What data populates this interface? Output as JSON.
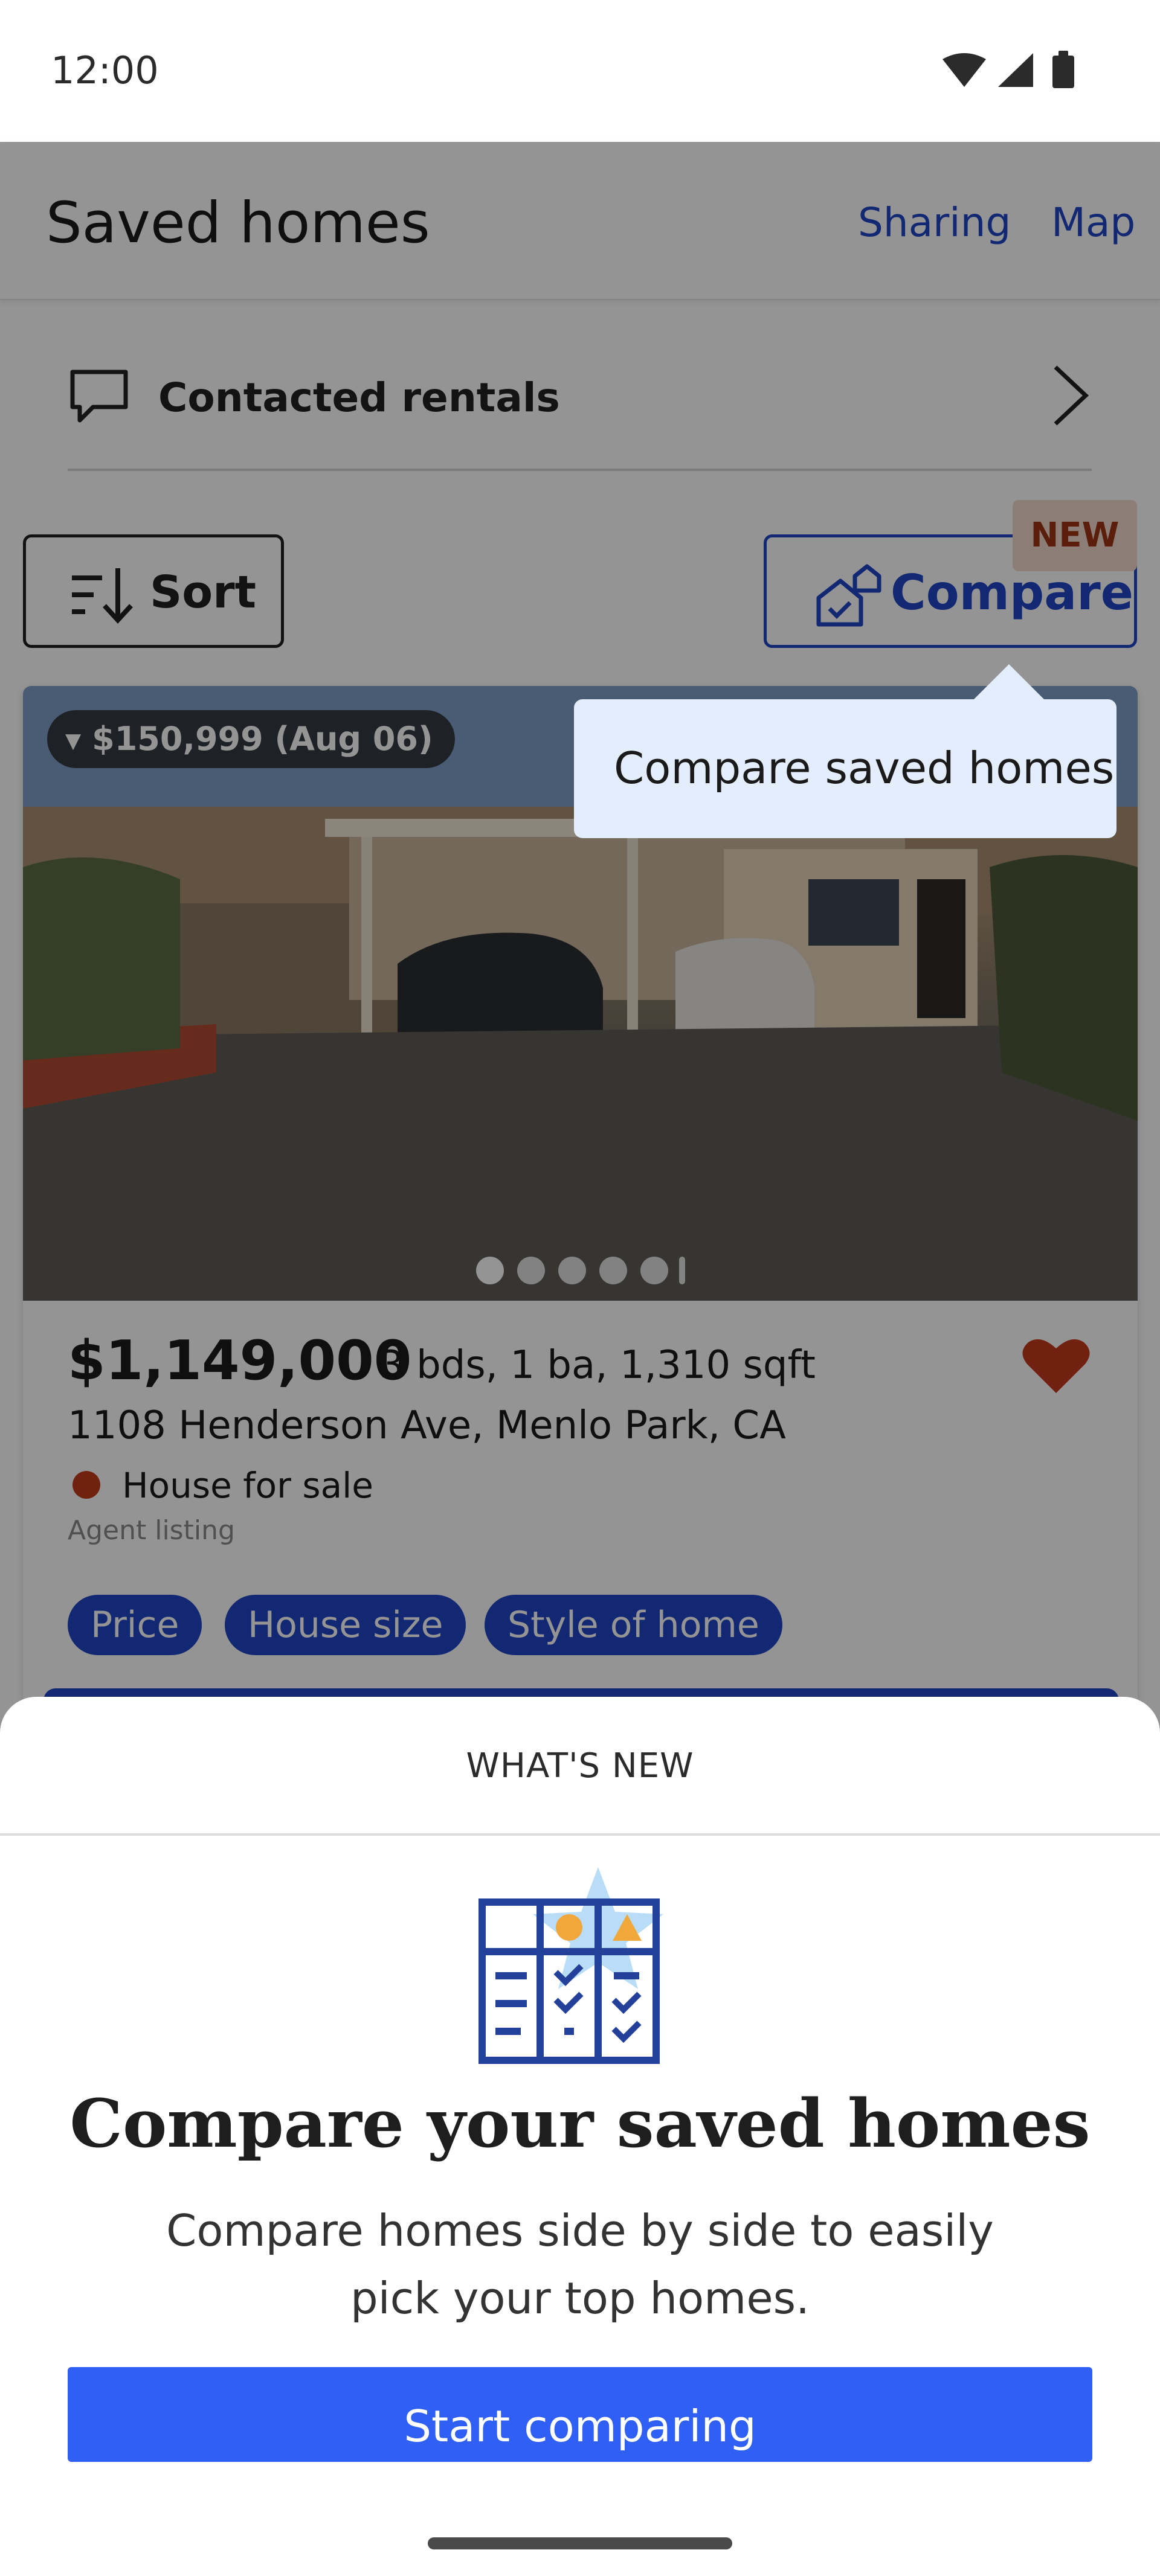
{
  "status_bar": {
    "time": "12:00",
    "icons": [
      "wifi-icon",
      "signal-icon",
      "battery-icon"
    ]
  },
  "header": {
    "title": "Saved homes",
    "sharing_label": "Sharing",
    "map_label": "Map"
  },
  "contacted": {
    "label": "Contacted rentals",
    "icon": "chat-bubble-icon"
  },
  "toolbar": {
    "sort_label": "Sort",
    "compare_label": "Compare",
    "new_badge": "NEW"
  },
  "tooltip": {
    "text": "Compare saved homes"
  },
  "listing": {
    "price_change": "$150,999 (Aug 06)",
    "price": "$1,149,000",
    "specs": "3 bds,  1 ba,  1,310 sqft",
    "address": "1108 Henderson Ave, Menlo Park, CA",
    "status": "House for sale",
    "agent": "Agent listing",
    "saved": true,
    "photo_count_visible": 5,
    "active_photo_index": 0,
    "chips": [
      "Price",
      "House size",
      "Style of home"
    ]
  },
  "sheet": {
    "heading": "WHAT'S NEW",
    "title": "Compare your saved homes",
    "body": "Compare homes side by side to easily pick your top homes.",
    "button_label": "Start comparing"
  },
  "colors": {
    "brand_blue": "#2146c7",
    "button_blue": "#2f5ff5",
    "heart_red": "#c2391b",
    "badge_bg": "#f2d9cd",
    "tooltip_bg": "#e3edfb"
  }
}
